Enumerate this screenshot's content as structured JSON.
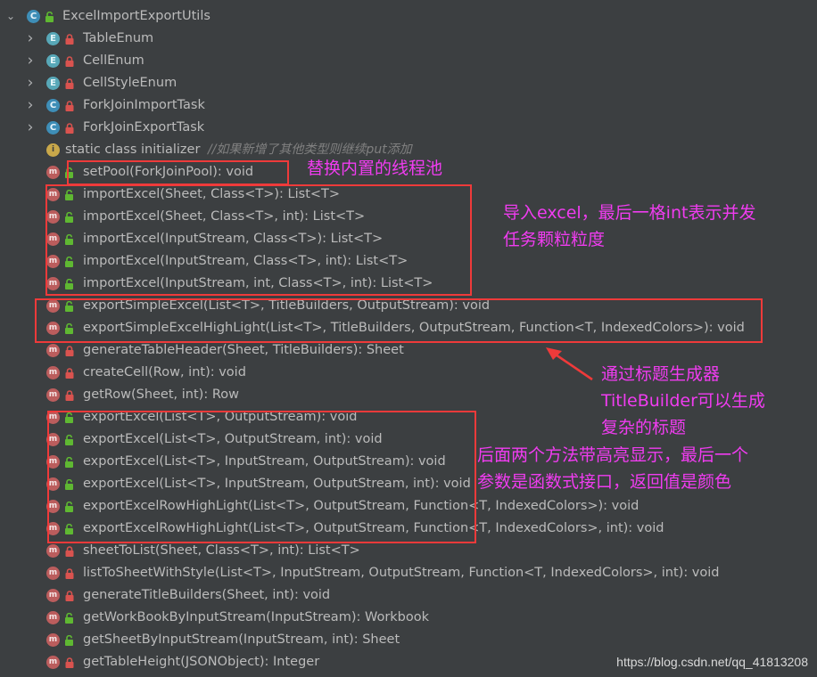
{
  "tree": {
    "root": {
      "label": "ExcelImportExportUtils",
      "type": "class"
    },
    "rows": [
      {
        "indent": 1,
        "expandable": true,
        "type": "enum",
        "vis": "private",
        "label": "TableEnum"
      },
      {
        "indent": 1,
        "expandable": true,
        "type": "enum",
        "vis": "private",
        "label": "CellEnum"
      },
      {
        "indent": 1,
        "expandable": true,
        "type": "enum",
        "vis": "private",
        "label": "CellStyleEnum"
      },
      {
        "indent": 1,
        "expandable": true,
        "type": "class",
        "vis": "private",
        "label": "ForkJoinImportTask"
      },
      {
        "indent": 1,
        "expandable": true,
        "type": "class",
        "vis": "private",
        "label": "ForkJoinExportTask"
      },
      {
        "indent": 1,
        "expandable": false,
        "type": "initializer",
        "vis": "none",
        "label": "static class initializer",
        "comment": "//如果新增了其他类型则继续put添加"
      },
      {
        "indent": 1,
        "expandable": false,
        "type": "method",
        "vis": "public",
        "label": "setPool(ForkJoinPool): void"
      },
      {
        "indent": 1,
        "expandable": false,
        "type": "method",
        "vis": "public",
        "label": "importExcel(Sheet, Class<T>): List<T>"
      },
      {
        "indent": 1,
        "expandable": false,
        "type": "method",
        "vis": "public",
        "label": "importExcel(Sheet, Class<T>, int): List<T>"
      },
      {
        "indent": 1,
        "expandable": false,
        "type": "method",
        "vis": "public",
        "label": "importExcel(InputStream, Class<T>): List<T>"
      },
      {
        "indent": 1,
        "expandable": false,
        "type": "method",
        "vis": "public",
        "label": "importExcel(InputStream, Class<T>, int): List<T>"
      },
      {
        "indent": 1,
        "expandable": false,
        "type": "method",
        "vis": "public",
        "label": "importExcel(InputStream, int, Class<T>, int): List<T>"
      },
      {
        "indent": 1,
        "expandable": false,
        "type": "method",
        "vis": "public",
        "label": "exportSimpleExcel(List<T>, TitleBuilders, OutputStream): void"
      },
      {
        "indent": 1,
        "expandable": false,
        "type": "method",
        "vis": "public",
        "label": "exportSimpleExcelHighLight(List<T>, TitleBuilders, OutputStream, Function<T, IndexedColors>): void"
      },
      {
        "indent": 1,
        "expandable": false,
        "type": "method",
        "vis": "private",
        "label": "generateTableHeader(Sheet, TitleBuilders): Sheet"
      },
      {
        "indent": 1,
        "expandable": false,
        "type": "method",
        "vis": "private",
        "label": "createCell(Row, int): void"
      },
      {
        "indent": 1,
        "expandable": false,
        "type": "method",
        "vis": "private",
        "label": "getRow(Sheet, int): Row"
      },
      {
        "indent": 1,
        "expandable": false,
        "type": "method",
        "vis": "public",
        "label": "exportExcel(List<T>, OutputStream): void"
      },
      {
        "indent": 1,
        "expandable": false,
        "type": "method",
        "vis": "public",
        "label": "exportExcel(List<T>, OutputStream, int): void"
      },
      {
        "indent": 1,
        "expandable": false,
        "type": "method",
        "vis": "public",
        "label": "exportExcel(List<T>, InputStream, OutputStream): void"
      },
      {
        "indent": 1,
        "expandable": false,
        "type": "method",
        "vis": "public",
        "label": "exportExcel(List<T>, InputStream, OutputStream, int): void"
      },
      {
        "indent": 1,
        "expandable": false,
        "type": "method",
        "vis": "public",
        "label": "exportExcelRowHighLight(List<T>, OutputStream, Function<T, IndexedColors>): void"
      },
      {
        "indent": 1,
        "expandable": false,
        "type": "method",
        "vis": "public",
        "label": "exportExcelRowHighLight(List<T>, OutputStream, Function<T, IndexedColors>, int): void"
      },
      {
        "indent": 1,
        "expandable": false,
        "type": "method",
        "vis": "private",
        "label": "sheetToList(Sheet, Class<T>, int): List<T>"
      },
      {
        "indent": 1,
        "expandable": false,
        "type": "method",
        "vis": "private",
        "label": "listToSheetWithStyle(List<T>, InputStream, OutputStream, Function<T, IndexedColors>, int): void"
      },
      {
        "indent": 1,
        "expandable": false,
        "type": "method",
        "vis": "private",
        "label": "generateTitleBuilders(Sheet, int): void"
      },
      {
        "indent": 1,
        "expandable": false,
        "type": "method",
        "vis": "public",
        "label": "getWorkBookByInputStream(InputStream): Workbook"
      },
      {
        "indent": 1,
        "expandable": false,
        "type": "method",
        "vis": "public",
        "label": "getSheetByInputStream(InputStream, int): Sheet"
      },
      {
        "indent": 1,
        "expandable": false,
        "type": "method",
        "vis": "private",
        "label": "getTableHeight(JSONObject): Integer"
      }
    ]
  },
  "annotations": {
    "pool": "替换内置的线程池",
    "import_line1": "导入excel，最后一格int表示并发",
    "import_line2": "任务颗粒粒度",
    "title_line1": "通过标题生成器",
    "title_line2": "TitleBuilder可以生成",
    "title_line3": "复杂的标题",
    "highlight_line1": "后面两个方法带高亮显示，最后一个",
    "highlight_line2": "参数是函数式接口，返回值是颜色"
  },
  "watermark": "https://blog.csdn.net/qq_41813208",
  "icons": {
    "expand": "chevron-right-icon",
    "collapse": "chevron-down-icon",
    "class": "class-icon",
    "enum": "enum-icon",
    "method": "method-icon",
    "initializer": "initializer-icon",
    "public": "unlock-icon",
    "private": "lock-icon"
  },
  "colors": {
    "background": "#3c3f41",
    "text": "#bbbbbb",
    "comment": "#808080",
    "annotation_box": "#ef3a3a",
    "annotation_text": "#f03cf0",
    "public_icon": "#5fb832",
    "private_icon": "#d9534f",
    "method_icon": "#bb5d5d",
    "class_icon": "#3e8eb7",
    "enum_icon": "#58a8b8"
  }
}
